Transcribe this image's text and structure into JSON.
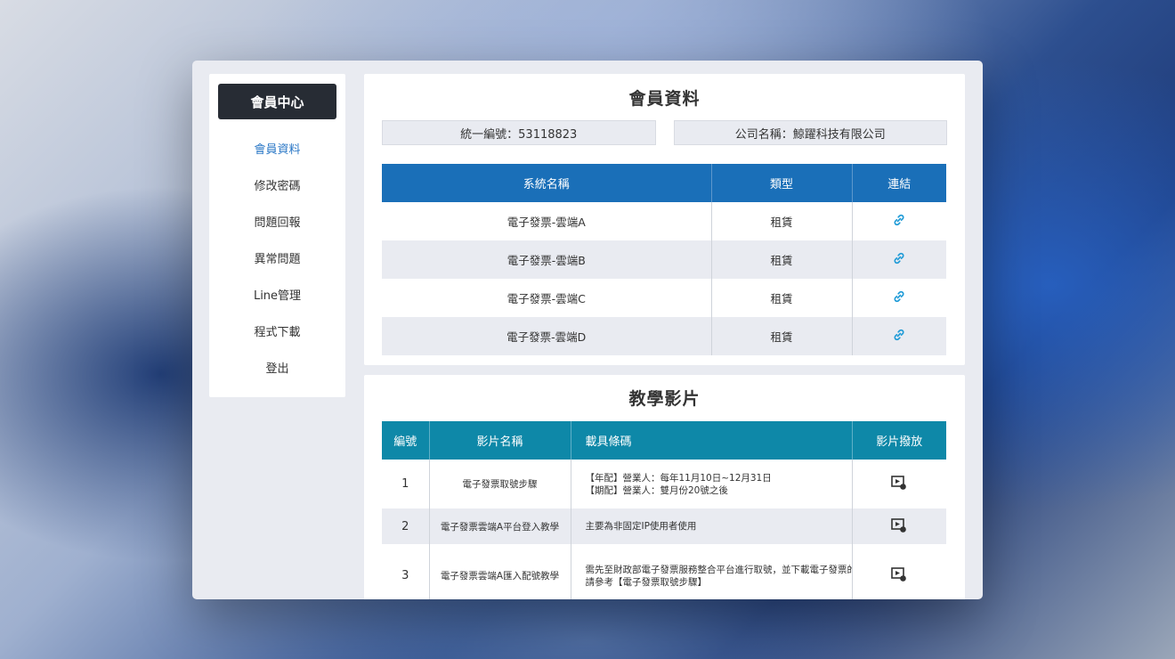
{
  "sidebar": {
    "title": "會員中心",
    "items": [
      {
        "label": "會員資料",
        "active": true
      },
      {
        "label": "修改密碼"
      },
      {
        "label": "問題回報"
      },
      {
        "label": "異常問題"
      },
      {
        "label": "Line管理"
      },
      {
        "label": "程式下載"
      },
      {
        "label": "登出"
      }
    ]
  },
  "member": {
    "title": "會員資料",
    "tax_id": "統一編號：53118823",
    "company": "公司名稱：鯨躍科技有限公司",
    "table": {
      "headers": [
        "系統名稱",
        "類型",
        "連結"
      ],
      "rows": [
        {
          "name": "電子發票-雲端A",
          "type": "租賃",
          "link_icon": "link-icon"
        },
        {
          "name": "電子發票-雲端B",
          "type": "租賃",
          "link_icon": "link-icon"
        },
        {
          "name": "電子發票-雲端C",
          "type": "租賃",
          "link_icon": "link-icon"
        },
        {
          "name": "電子發票-雲端D",
          "type": "租賃",
          "link_icon": "link-icon"
        }
      ]
    }
  },
  "videos": {
    "title": "教學影片",
    "table": {
      "headers": [
        "編號",
        "影片名稱",
        "載具條碼",
        "影片撥放"
      ],
      "rows": [
        {
          "no": "1",
          "name": "電子發票取號步驟",
          "desc1": "【年配】營業人：每年11月10日~12月31日",
          "desc2": "【期配】營業人：雙月份20號之後",
          "play_icon": "video-play-icon"
        },
        {
          "no": "2",
          "name": "電子發票雲端A平台登入教學",
          "desc1": "主要為非固定IP使用者使用",
          "desc2": "",
          "play_icon": "video-play-icon"
        },
        {
          "no": "3",
          "name": "電子發票雲端A匯入配號教學",
          "desc1": "需先至財政部電子發票服務整合平台進行取號，並下載電子發票的配號檔",
          "desc2": "請參考【電子發票取號步驟】",
          "play_icon": "video-play-icon"
        }
      ]
    }
  },
  "colors": {
    "sidebar_header": "#272c34",
    "active_menu": "#2a77c6",
    "system_table_header": "#1a6fb8",
    "video_table_header": "#0e88a8",
    "link_icon": "#1f9bd7",
    "stripe": "#e9ebf1"
  }
}
